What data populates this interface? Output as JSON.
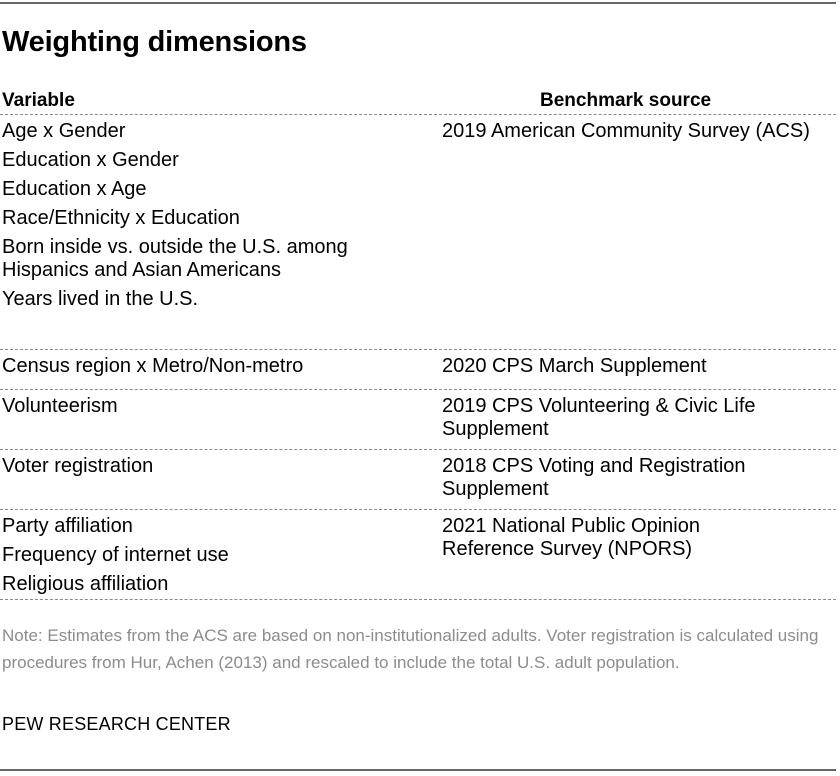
{
  "title": "Weighting dimensions",
  "table": {
    "headers": {
      "variable": "Variable",
      "source": "Benchmark source"
    },
    "rows": [
      {
        "variables": [
          "Age x Gender",
          "Education x Gender",
          "Education x Age",
          "Race/Ethnicity x Education",
          "Born inside vs. outside the U.S. among Hispanics and Asian Americans",
          "Years lived in the U.S."
        ],
        "source": "2019 American Community Survey (ACS)"
      },
      {
        "variables": [
          "Census region x Metro/Non-metro"
        ],
        "source": "2020 CPS March Supplement"
      },
      {
        "variables": [
          "Volunteerism"
        ],
        "source": "2019 CPS Volunteering & Civic Life Supplement"
      },
      {
        "variables": [
          "Voter registration"
        ],
        "source": "2018 CPS Voting and Registration Supplement"
      },
      {
        "variables": [
          "Party affiliation",
          "Frequency of internet use",
          "Religious affiliation"
        ],
        "source": "2021 National Public Opinion Reference Survey (NPORS)"
      }
    ]
  },
  "note": "Note: Estimates from the ACS are based on non-institutionalized adults. Voter registration is calculated using procedures from Hur, Achen (2013) and rescaled to include the total U.S. adult population.",
  "footer": "PEW RESEARCH CENTER"
}
